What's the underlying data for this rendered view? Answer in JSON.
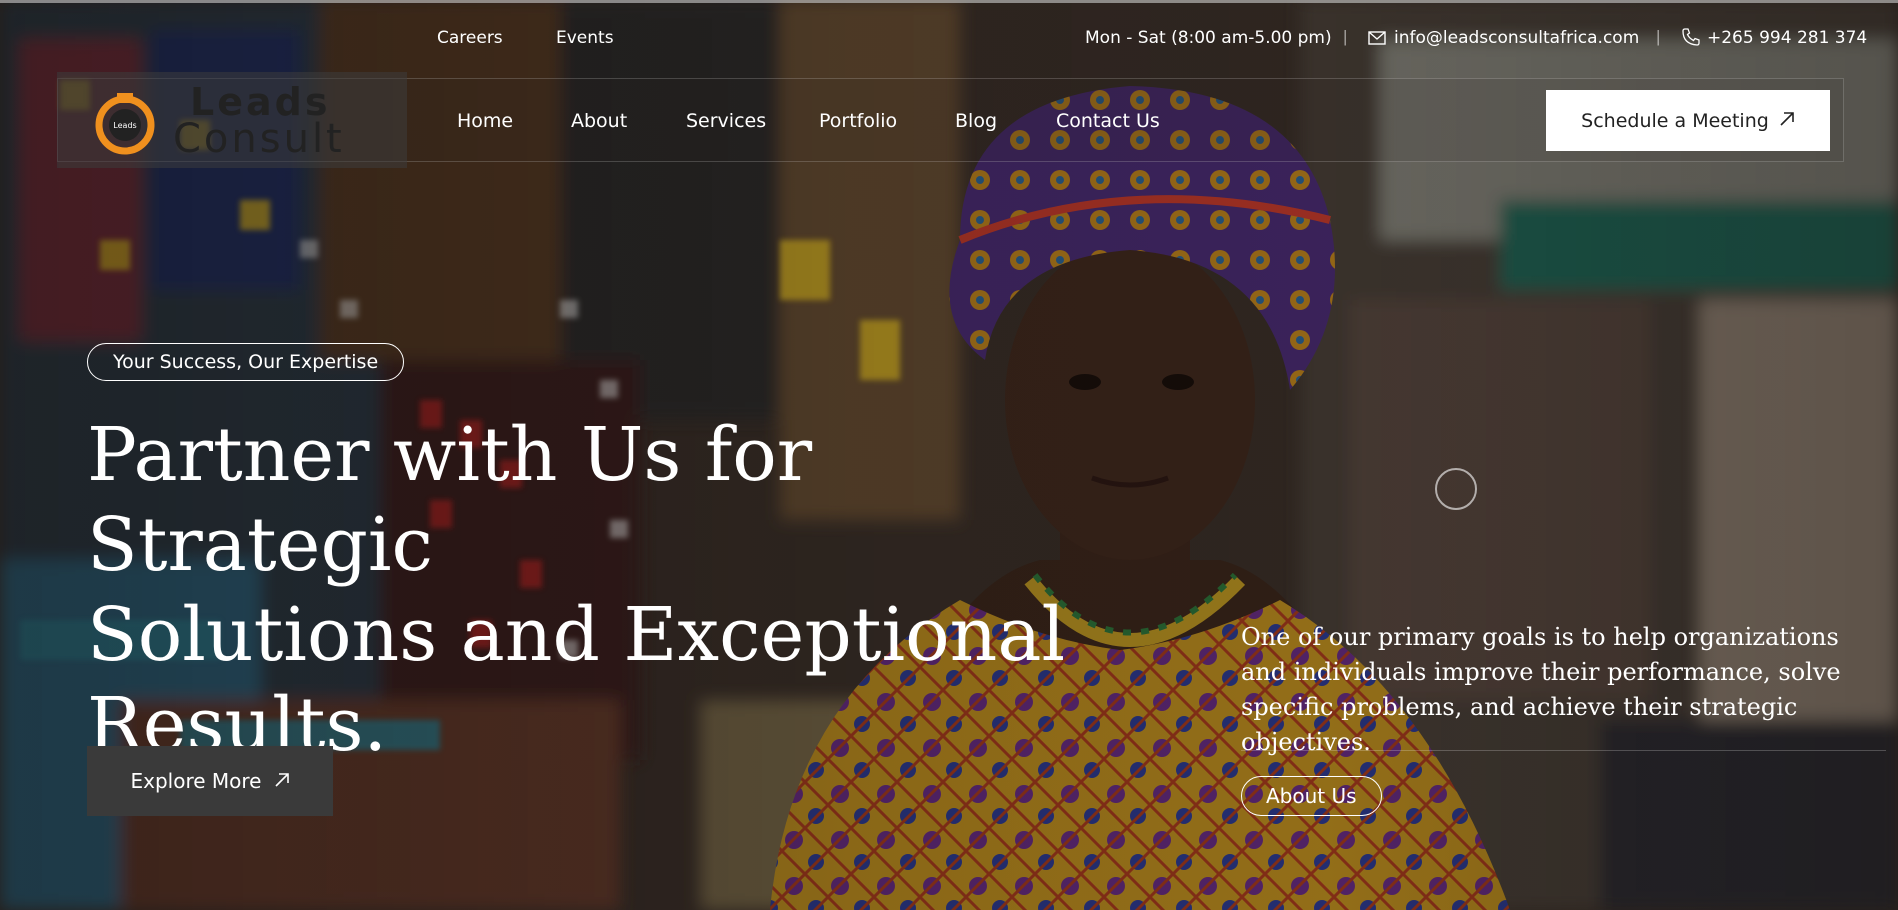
{
  "topbar": {
    "links": [
      "Careers",
      "Events"
    ],
    "hours": "Mon - Sat (8:00 am-5.00 pm)",
    "email": "info@leadsconsultafrica.com",
    "phone": "+265 994 281 374",
    "email_icon": "envelope-icon",
    "phone_icon": "phone-icon"
  },
  "logo": {
    "line1": "Leads",
    "line2": "Consult",
    "ring_text": "Leads",
    "accent": "#f0901e"
  },
  "nav": {
    "items": [
      "Home",
      "About",
      "Services",
      "Portfolio",
      "Blog",
      "Contact Us"
    ]
  },
  "cta": {
    "label": "Schedule a Meeting",
    "icon": "arrow-up-right-icon"
  },
  "hero": {
    "tagline": "Your Success, Our Expertise",
    "headline_1": "Partner with Us for Strategic",
    "headline_2": "Solutions and Exceptional",
    "headline_3": "Results.",
    "explore_label": "Explore More",
    "explore_icon": "arrow-up-right-icon",
    "blurb": "One of our primary goals is to help organizations and individuals improve their performance, solve specific problems, and achieve their strategic objectives.",
    "about_label": "About Us"
  },
  "colors": {
    "overlay": "#14100e",
    "button_dark": "#3a3a3a",
    "cta_bg": "#ffffff",
    "accent_orange": "#f0901e"
  }
}
